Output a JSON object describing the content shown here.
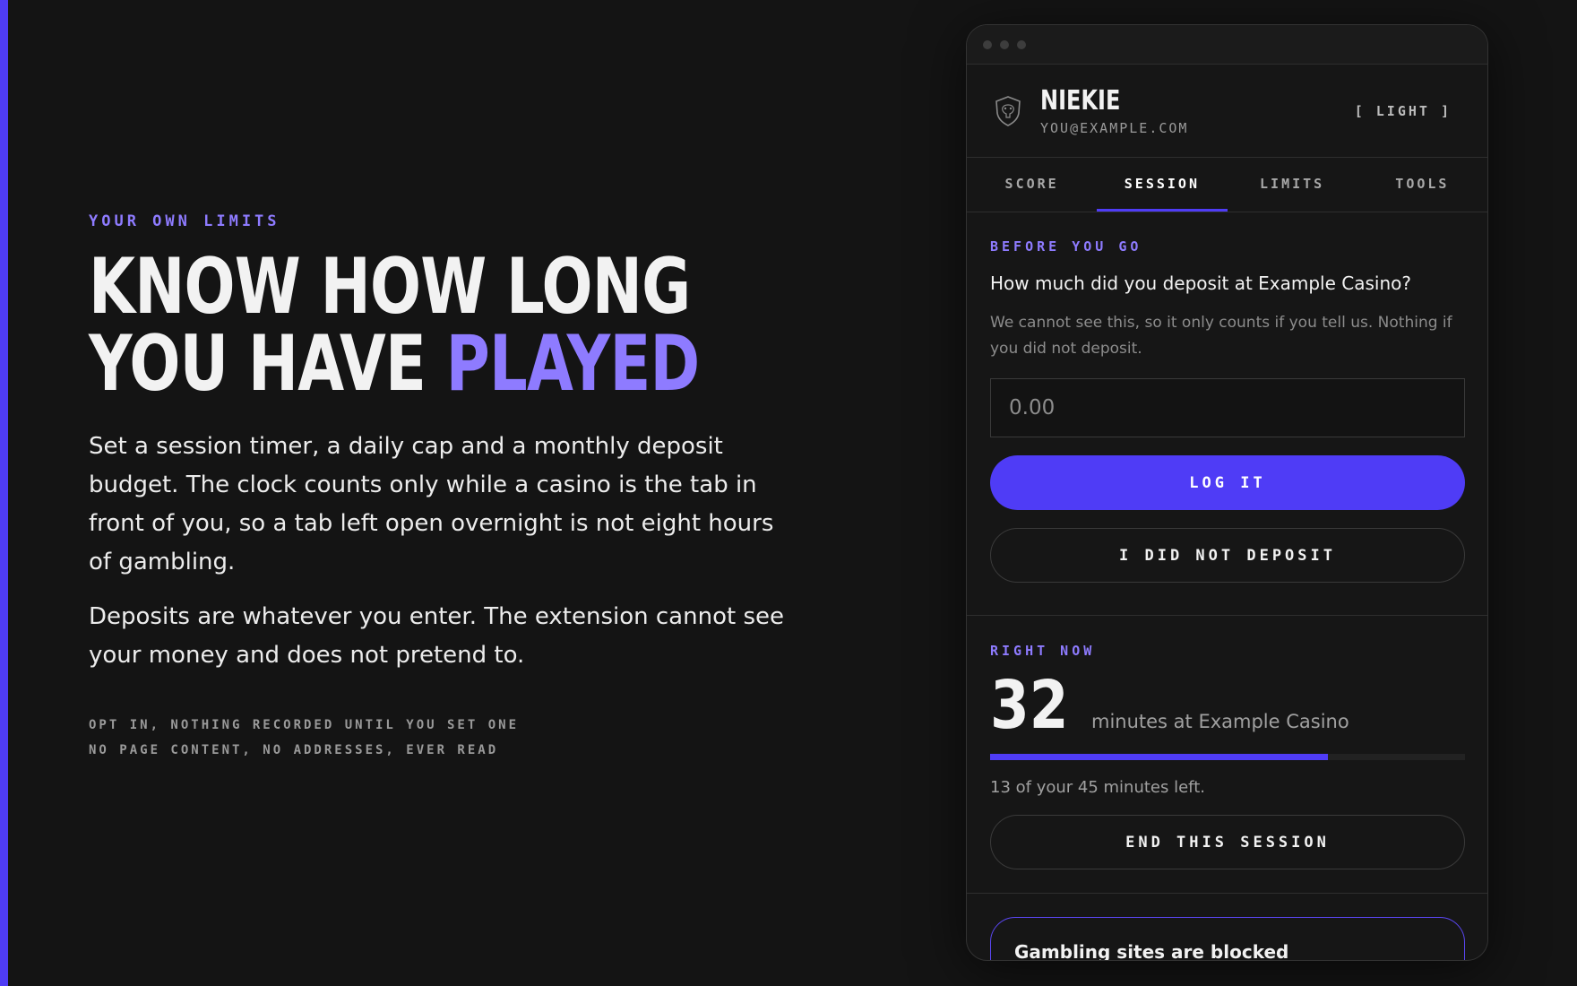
{
  "hero": {
    "eyebrow": "YOUR OWN LIMITS",
    "headline_line1": "KNOW HOW LONG",
    "headline_line2_plain": "YOU HAVE ",
    "headline_line2_highlight": "PLAYED",
    "paragraph1": "Set a session timer, a daily cap and a monthly deposit budget. The clock counts only while a casino is the tab in front of you, so a tab left open overnight is not eight hours of gambling.",
    "paragraph2": "Deposits are whatever you enter. The extension cannot see your money and does not pretend to.",
    "note1": "OPT IN, NOTHING RECORDED UNTIL YOU SET ONE",
    "note2": "NO PAGE CONTENT, NO ADDRESSES, EVER READ"
  },
  "panel": {
    "profile": {
      "name": "NIEKIE",
      "email": "YOU@EXAMPLE.COM",
      "theme_toggle": "[ LIGHT ]",
      "avatar_icon": "shield-crest-icon"
    },
    "tabs": [
      {
        "label": "SCORE",
        "active": false
      },
      {
        "label": "SESSION",
        "active": true
      },
      {
        "label": "LIMITS",
        "active": false
      },
      {
        "label": "TOOLS",
        "active": false
      }
    ],
    "deposit": {
      "label": "BEFORE YOU GO",
      "question": "How much did you deposit at Example Casino?",
      "helper": "We cannot see this, so it only counts if you tell us. Nothing if you did not deposit.",
      "placeholder": "0.00",
      "log_button": "LOG IT",
      "no_deposit_button": "I DID NOT DEPOSIT"
    },
    "session": {
      "label": "RIGHT NOW",
      "minutes": "32",
      "unit_text": "minutes at Example Casino",
      "progress_fraction": 0.711,
      "remaining_text": "13 of your 45 minutes left.",
      "end_button": "END THIS SESSION"
    },
    "blocked": {
      "title": "Gambling sites are blocked"
    }
  },
  "colors": {
    "accent": "#4f3cf6",
    "accent_light": "#8e7bff",
    "background": "#141414"
  }
}
